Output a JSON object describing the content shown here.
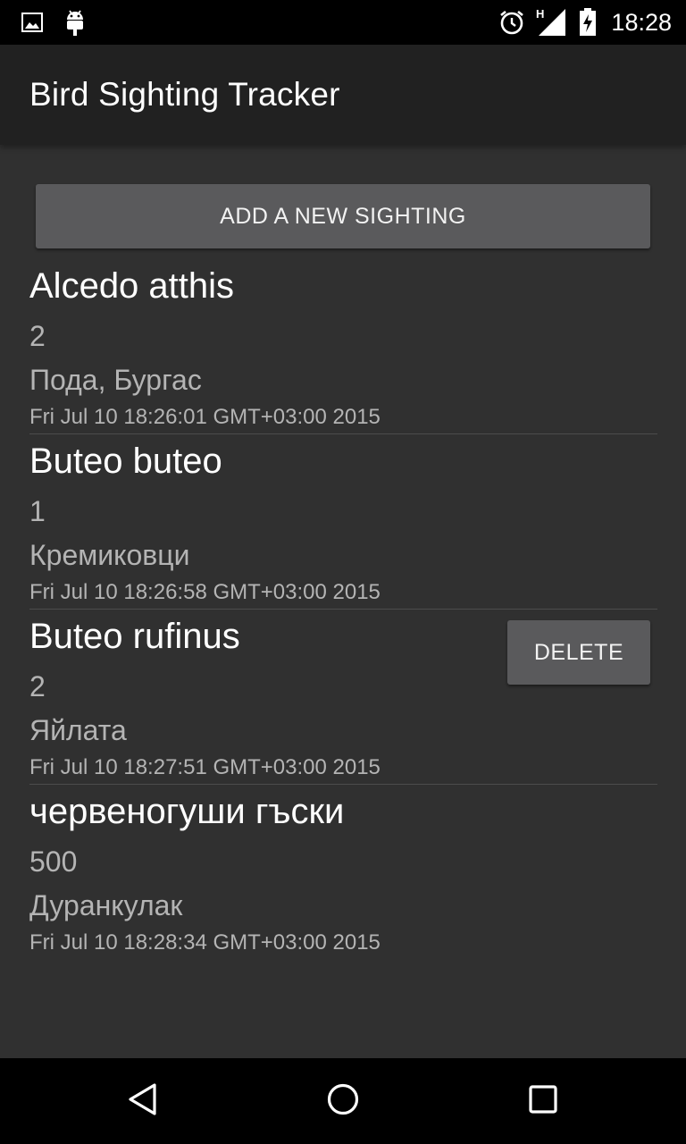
{
  "status_bar": {
    "time": "18:28",
    "network_type": "H",
    "icons": [
      "image-icon",
      "android-icon",
      "alarm-icon",
      "signal-icon",
      "battery-icon"
    ]
  },
  "app_bar": {
    "title": "Bird Sighting Tracker"
  },
  "add_button": {
    "label": "ADD A NEW SIGHTING"
  },
  "sightings": [
    {
      "name": "Alcedo atthis",
      "count": "2",
      "location": "Пода, Бургас",
      "date": "Fri Jul 10 18:26:01 GMT+03:00 2015"
    },
    {
      "name": "Buteo buteo",
      "count": "1",
      "location": "Кремиковци",
      "date": "Fri Jul 10 18:26:58 GMT+03:00 2015"
    },
    {
      "name": "Buteo rufinus",
      "count": "2",
      "location": "Яйлата",
      "date": "Fri Jul 10 18:27:51 GMT+03:00 2015"
    },
    {
      "name": "червеногуши гъски",
      "count": "500",
      "location": "Дуранкулак",
      "date": "Fri Jul 10 18:28:34 GMT+03:00 2015"
    }
  ],
  "delete_button": {
    "label": "DELETE"
  },
  "nav_bar": {
    "icons": [
      "back-icon",
      "home-icon",
      "recents-icon"
    ]
  },
  "colors": {
    "background": "#303030",
    "app_bar": "#212121",
    "status_bar": "#000000",
    "button": "#5a5a5c",
    "primary_text": "#ffffff",
    "secondary_text": "#b4b4b4"
  }
}
